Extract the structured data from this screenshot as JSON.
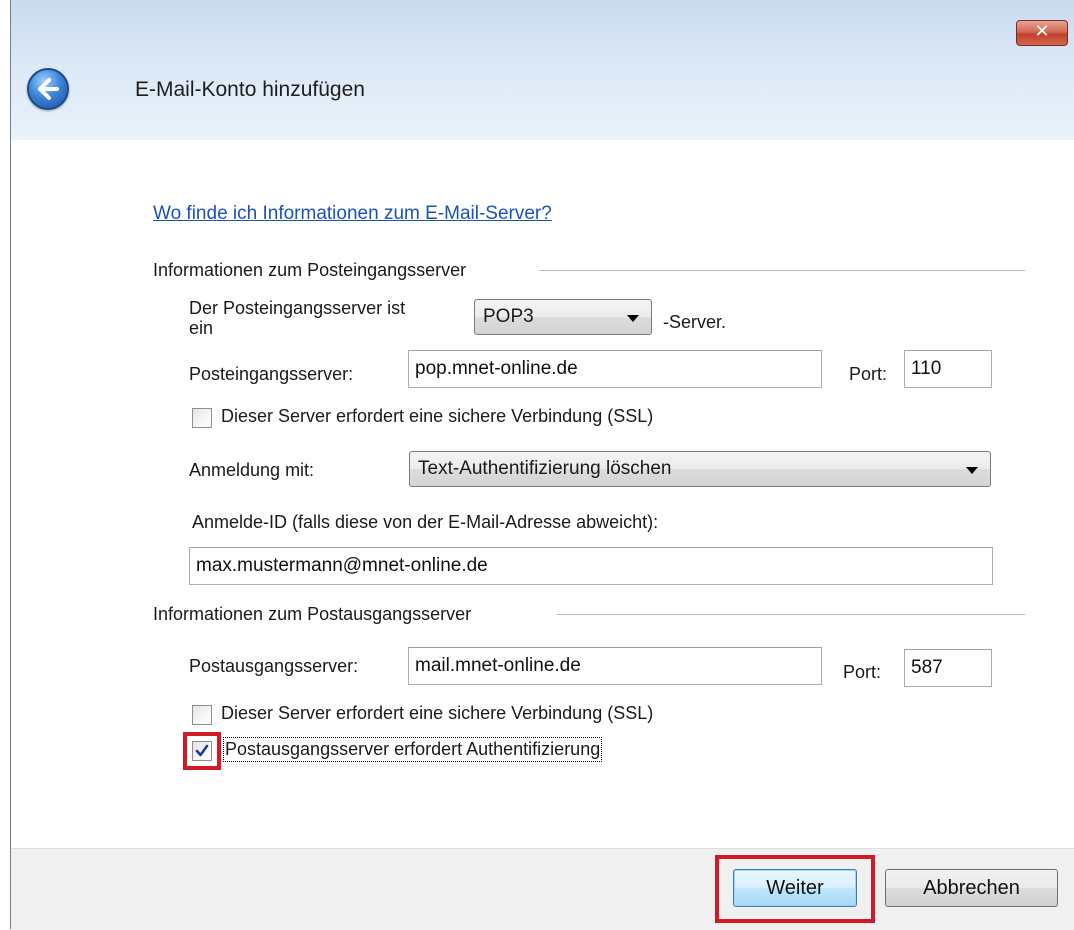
{
  "window": {
    "title": "E-Mail-Konto hinzufügen",
    "close_glyph": "✕"
  },
  "help_link": "Wo finde ich Informationen zum E-Mail-Server?",
  "incoming": {
    "section_label": "Informationen zum Posteingangsserver",
    "server_type_label_line1": "Der Posteingangsserver ist",
    "server_type_label_line2": "ein",
    "server_type_value": "POP3",
    "server_type_suffix": "-Server.",
    "server_label": "Posteingangsserver:",
    "server_value": "pop.mnet-online.de",
    "port_label": "Port:",
    "port_value": "110",
    "ssl_label": "Dieser Server erfordert eine sichere Verbindung (SSL)",
    "ssl_checked": false,
    "login_label": "Anmeldung mit:",
    "login_value": "Text-Authentifizierung löschen",
    "login_id_label": "Anmelde-ID (falls diese von der E-Mail-Adresse abweicht):",
    "login_id_value": "max.mustermann@mnet-online.de"
  },
  "outgoing": {
    "section_label": "Informationen zum Postausgangsserver",
    "server_label": "Postausgangsserver:",
    "server_value": "mail.mnet-online.de",
    "port_label": "Port:",
    "port_value": "587",
    "ssl_label": "Dieser Server erfordert eine sichere Verbindung (SSL)",
    "ssl_checked": false,
    "auth_label": "Postausgangsserver erfordert Authentifizierung",
    "auth_checked": true
  },
  "footer": {
    "next_label": "Weiter",
    "cancel_label": "Abbrechen"
  },
  "colors": {
    "highlight": "#d11a26",
    "link": "#1a52b8"
  }
}
